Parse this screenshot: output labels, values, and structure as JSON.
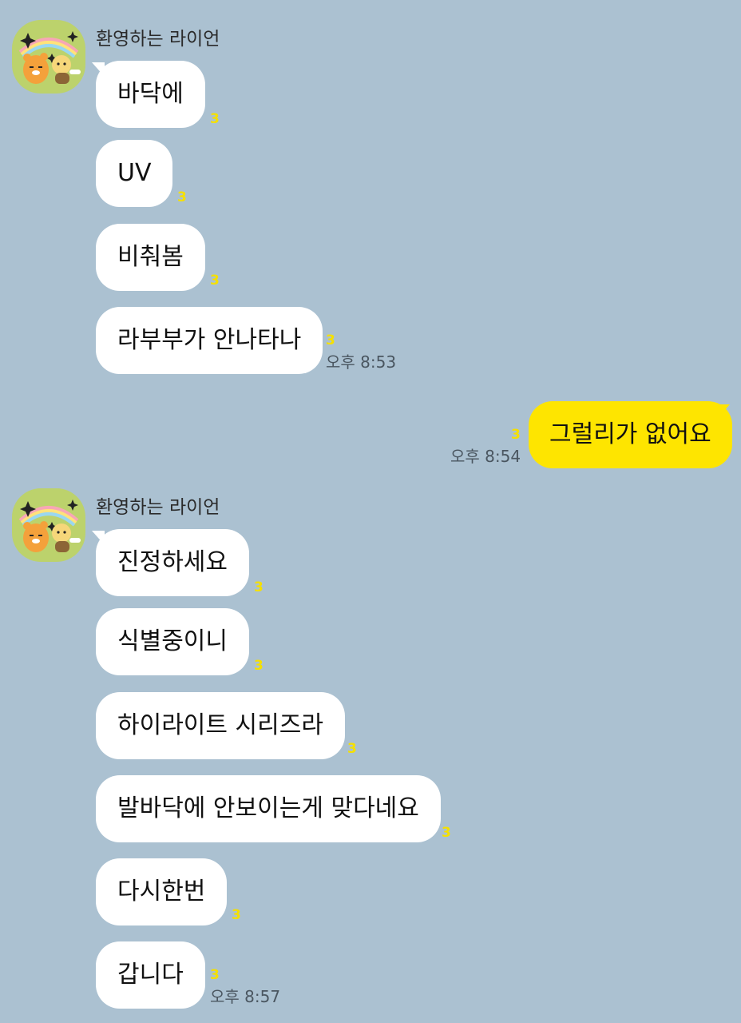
{
  "groups": [
    {
      "sender": "환영하는 라이언",
      "messages": [
        {
          "text": "바닥에",
          "unread": "3"
        },
        {
          "text": "UV",
          "unread": "3"
        },
        {
          "text": "비춰봄",
          "unread": "3"
        },
        {
          "text": "라부부가 안나타나",
          "unread": "3",
          "time": "오후 8:53"
        }
      ]
    },
    {
      "sender": "me",
      "messages": [
        {
          "text": "그럴리가 없어요",
          "unread": "3",
          "time": "오후 8:54"
        }
      ]
    },
    {
      "sender": "환영하는 라이언",
      "messages": [
        {
          "text": "진정하세요",
          "unread": "3"
        },
        {
          "text": "식별중이니",
          "unread": "3"
        },
        {
          "text": "하이라이트 시리즈라",
          "unread": "3"
        },
        {
          "text": "발바닥에 안보이는게 맞다네요",
          "unread": "3"
        },
        {
          "text": "다시한번",
          "unread": "3"
        },
        {
          "text": "갑니다",
          "unread": "3",
          "time": "오후 8:57"
        }
      ]
    }
  ],
  "colors": {
    "background": "#abc1d1",
    "incoming_bubble": "#ffffff",
    "outgoing_bubble": "#fee500",
    "unread_count": "#f5e000"
  },
  "icons": {
    "avatar": "ryan-choonsik-avatar-icon"
  }
}
